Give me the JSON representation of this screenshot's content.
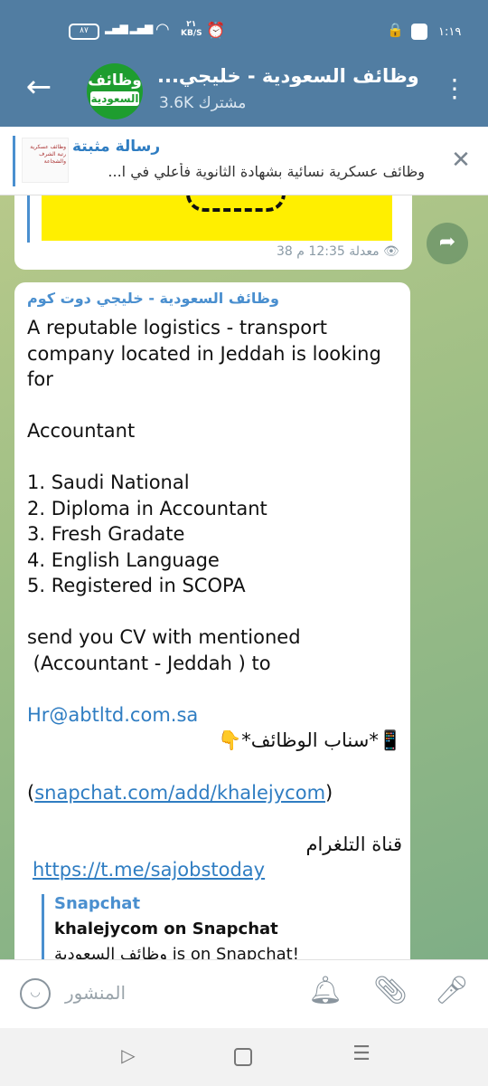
{
  "status_bar": {
    "battery": "٨٧",
    "speed": "٢١\nKB/S",
    "time": "١:١٩"
  },
  "header": {
    "avatar_line1": "وظائف",
    "avatar_line2": "السعودية",
    "title": "وظائف السعودية - خليجي...",
    "subscribers": "3.6K مشترك"
  },
  "pinned": {
    "title": "رسالة مثبتة",
    "text": "وظائف عسكرية نسائية بشهادة الثانوية فأعلي في ا...",
    "thumb_text": "وظائف عسكرية رتبة الشرف والشجاعة"
  },
  "message1": {
    "meta": "معدلة 12:35 م  38"
  },
  "message2": {
    "sender": "وظائف السعودية - خليجي دوت كوم",
    "line1": "A reputable logistics - transport company located in Jeddah is looking for",
    "line2": "Accountant",
    "req1": "1. Saudi National",
    "req2": "2. Diploma in Accountant",
    "req3": "3. Fresh Gradate",
    "req4": "4. English Language",
    "req5": "5. Registered in SCOPA",
    "cv1": "send you CV with mentioned",
    "cv2": " (Accountant - Jeddah ) to",
    "email": "Hr@abtltd.com.sa",
    "snap_label": "📱*سناب الوظائف*👇",
    "snap_open": "(",
    "snap_link": "snapchat.com/add/khalejycom",
    "snap_close": ")",
    "tg_label": "قناة التلغرام",
    "tg_link": "https://t.me/sajobstoday",
    "preview_site": "Snapchat",
    "preview_title": "khalejycom on Snapchat",
    "preview_desc": "وظائف السعودية is on Snapchat!"
  },
  "input": {
    "placeholder": "المنشور"
  },
  "icons": {
    "back": "arrow-left-icon",
    "menu": "dots-vertical-icon",
    "close": "close-icon",
    "share": "share-icon",
    "eye": "eye-icon",
    "emoji": "emoji-icon",
    "bell": "bell-icon",
    "attach": "paperclip-icon",
    "mic": "microphone-icon"
  },
  "colors": {
    "header": "#517da2",
    "accent": "#4a8fcf",
    "link": "#2f7dc2"
  }
}
